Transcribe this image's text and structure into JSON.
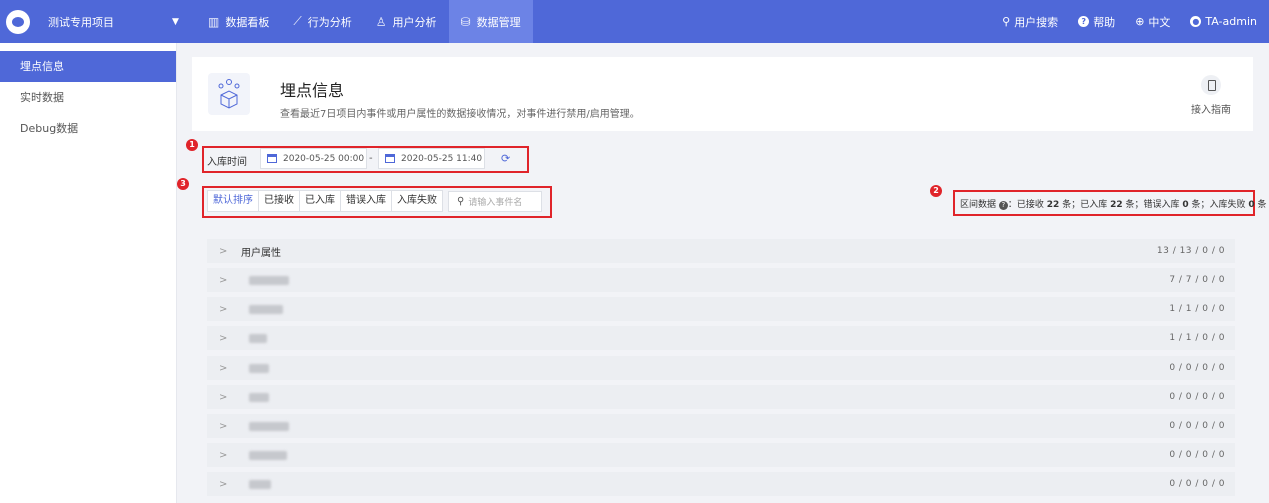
{
  "topbar": {
    "project_name": "测试专用项目",
    "nav": [
      {
        "label": "数据看板",
        "icon": "bar-chart-icon",
        "glyph": "▥",
        "active": false
      },
      {
        "label": "行为分析",
        "icon": "trend-icon",
        "glyph": "⟋",
        "active": false
      },
      {
        "label": "用户分析",
        "icon": "user-icon",
        "glyph": "♙",
        "active": false
      },
      {
        "label": "数据管理",
        "icon": "database-icon",
        "glyph": "⛁",
        "active": true
      }
    ],
    "right": {
      "user_search": "用户搜索",
      "help": "帮助",
      "language": "中文",
      "account": "TA-admin"
    }
  },
  "sidebar": {
    "items": [
      {
        "label": "埋点信息",
        "active": true
      },
      {
        "label": "实时数据",
        "active": false
      },
      {
        "label": "Debug数据",
        "active": false
      }
    ]
  },
  "header": {
    "title": "埋点信息",
    "description": "查看最近7日项目内事件或用户属性的数据接收情况，对事件进行禁用/启用管理。",
    "guide_label": "接入指南"
  },
  "annotations": [
    "1",
    "2",
    "3"
  ],
  "filter": {
    "time_label": "入库时间",
    "start": "2020-05-25 00:00",
    "separator": "-",
    "end": "2020-05-25 11:40"
  },
  "sort_tabs": [
    "默认排序",
    "已接收",
    "已入库",
    "错误入库",
    "入库失败"
  ],
  "search_placeholder": "请输入事件名",
  "stats": {
    "label": "区间数据",
    "received_label": "：已接收",
    "received": "22",
    "stored_label": "条；已入库",
    "stored": "22",
    "error_label": "条；错误入库",
    "error": "0",
    "failed_label": "条；入库失败",
    "failed": "0",
    "unit": "条"
  },
  "rows": [
    {
      "name": "用户属性",
      "counts": "13 / 13 / 0 / 0"
    },
    {
      "name": "",
      "counts": "7 / 7 / 0 / 0"
    },
    {
      "name": "",
      "counts": "1 / 1 / 0 / 0"
    },
    {
      "name": "",
      "counts": "1 / 1 / 0 / 0"
    },
    {
      "name": "",
      "counts": "0 / 0 / 0 / 0"
    },
    {
      "name": "",
      "counts": "0 / 0 / 0 / 0"
    },
    {
      "name": "",
      "counts": "0 / 0 / 0 / 0"
    },
    {
      "name": "",
      "counts": "0 / 0 / 0 / 0"
    },
    {
      "name": "",
      "counts": "0 / 0 / 0 / 0"
    }
  ],
  "colors": {
    "brand": "#4f68d8",
    "highlight": "#e0242a"
  }
}
